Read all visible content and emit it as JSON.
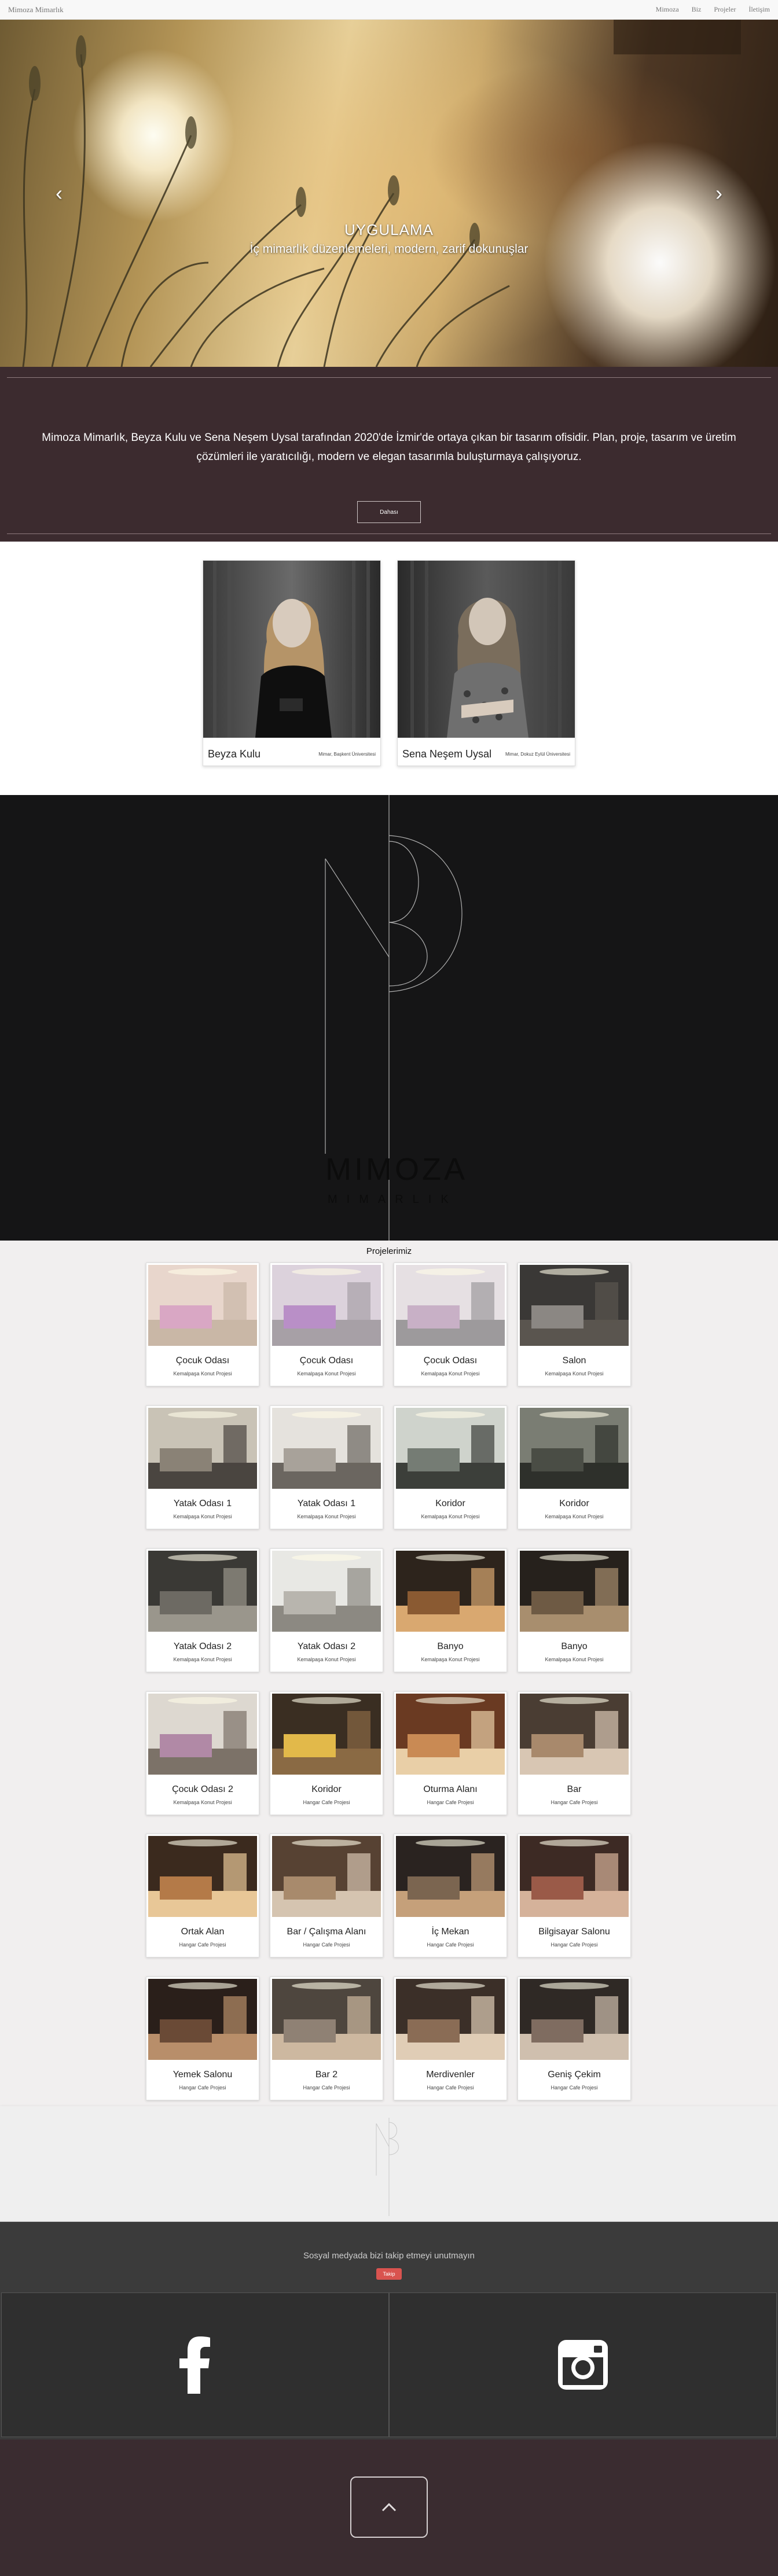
{
  "navbar": {
    "brand": "Mimoza Mimarlık",
    "links": [
      "Mimoza",
      "Biz",
      "Projeler",
      "İletişim"
    ]
  },
  "hero": {
    "heading": "UYGULAMA",
    "subtitle": "İç mimarlık düzenlemeleri, modern, zarif dokunuşlar",
    "prev_icon": "chevron-left-icon",
    "next_icon": "chevron-right-icon"
  },
  "about": {
    "text_line1": "Mimoza Mimarlık, Beyza Kulu ve Sena Neşem Uysal tarafından 2020'de İzmir'de ortaya çıkan bir tasarım ofisidir. Plan, proje, tasarım ve üretim",
    "text_line2": "çözümleri ile yaratıcılığı, modern ve elegan tasarımla buluşturmaya çalışıyoruz.",
    "button_label": "Dahası"
  },
  "team": [
    {
      "name": "Beyza Kulu",
      "education": "Mimar, Başkent Üniversitesi"
    },
    {
      "name": "Sena Neşem Uysal",
      "education": "Mimar, Dokuz Eylül Üniversitesi"
    }
  ],
  "logo": {
    "title": "MIMOZA",
    "subtitle": "MIMARLIK"
  },
  "projects": {
    "title": "Projelerimiz",
    "items": [
      {
        "title": "Çocuk Odası",
        "subtitle": "Kemalpaşa Konut Projesi"
      },
      {
        "title": "Çocuk Odası",
        "subtitle": "Kemalpaşa Konut Projesi"
      },
      {
        "title": "Çocuk Odası",
        "subtitle": "Kemalpaşa Konut Projesi"
      },
      {
        "title": "Salon",
        "subtitle": "Kemalpaşa Konut Projesi"
      },
      {
        "title": "Yatak Odası 1",
        "subtitle": "Kemalpaşa Konut Projesi"
      },
      {
        "title": "Yatak Odası 1",
        "subtitle": "Kemalpaşa Konut Projesi"
      },
      {
        "title": "Koridor",
        "subtitle": "Kemalpaşa Konut Projesi"
      },
      {
        "title": "Koridor",
        "subtitle": "Kemalpaşa Konut Projesi"
      },
      {
        "title": "Yatak Odası 2",
        "subtitle": "Kemalpaşa Konut Projesi"
      },
      {
        "title": "Yatak Odası 2",
        "subtitle": "Kemalpaşa Konut Projesi"
      },
      {
        "title": "Banyo",
        "subtitle": "Kemalpaşa Konut Projesi"
      },
      {
        "title": "Banyo",
        "subtitle": "Kemalpaşa Konut Projesi"
      },
      {
        "title": "Çocuk Odası 2",
        "subtitle": "Kemalpaşa Konut Projesi"
      },
      {
        "title": "Koridor",
        "subtitle": "Hangar Cafe Projesi"
      },
      {
        "title": "Oturma Alanı",
        "subtitle": "Hangar Cafe Projesi"
      },
      {
        "title": "Bar",
        "subtitle": "Hangar Cafe Projesi"
      },
      {
        "title": "Ortak Alan",
        "subtitle": "Hangar Cafe Projesi"
      },
      {
        "title": "Bar / Çalışma Alanı",
        "subtitle": "Hangar Cafe Projesi"
      },
      {
        "title": "İç Mekan",
        "subtitle": "Hangar Cafe Projesi"
      },
      {
        "title": "Bilgisayar Salonu",
        "subtitle": "Hangar Cafe Projesi"
      },
      {
        "title": "Yemek Salonu",
        "subtitle": "Hangar Cafe Projesi"
      },
      {
        "title": "Bar 2",
        "subtitle": "Hangar Cafe Projesi"
      },
      {
        "title": "Merdivenler",
        "subtitle": "Hangar Cafe Projesi"
      },
      {
        "title": "Geniş Çekim",
        "subtitle": "Hangar Cafe Projesi"
      }
    ]
  },
  "social": {
    "text": "Sosyal medyada bizi takip etmeyi unutmayın",
    "badge": "Takip",
    "facebook_icon": "facebook-icon",
    "instagram_icon": "instagram-icon"
  },
  "footer": {
    "top_icon": "chevron-up-icon"
  },
  "colors": {
    "about_bg": "#3c2b2f",
    "logo_bg": "#151516",
    "projects_bg": "#f1efef",
    "social_bg": "#3b3b3b",
    "footer_bg": "#3a2c30",
    "badge": "#d9534f"
  }
}
